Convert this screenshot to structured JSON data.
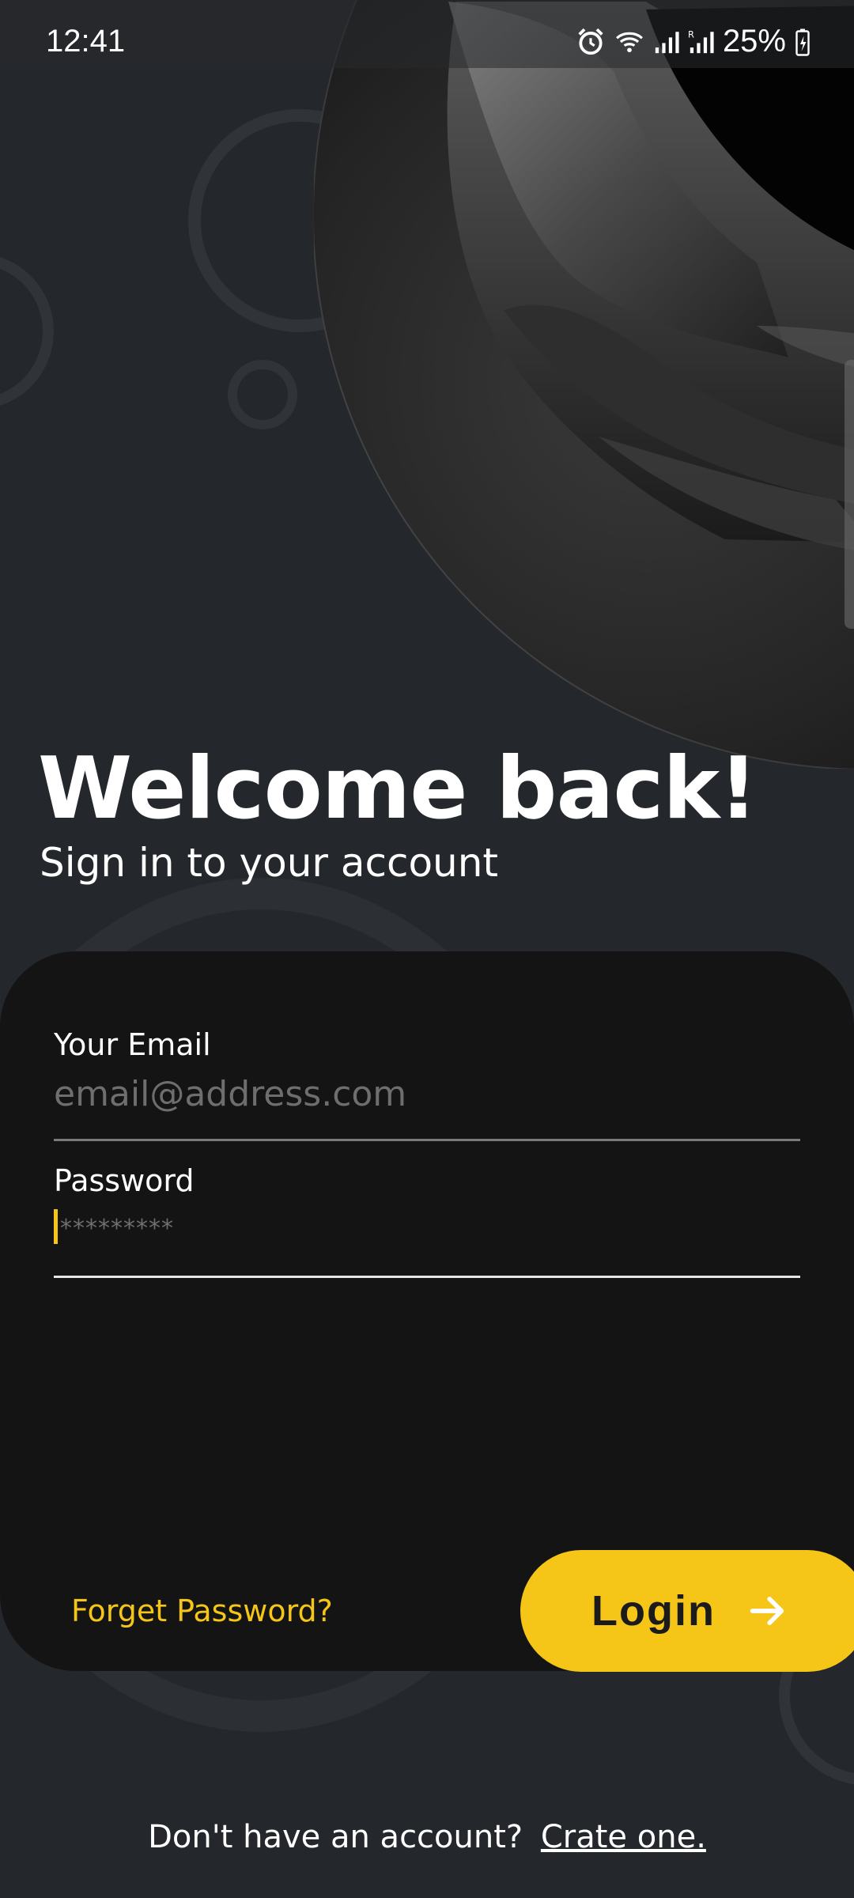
{
  "status_bar": {
    "time": "12:41",
    "battery": "25%",
    "icons": [
      "alarm-icon",
      "wifi-icon",
      "signal-icon",
      "signal-roaming-icon",
      "battery-charging-icon"
    ]
  },
  "hero": {
    "image": "hooded-figure-image"
  },
  "header": {
    "title": "Welcome back!",
    "subtitle": "Sign in to your account"
  },
  "form": {
    "email_label": "Your Email",
    "email_placeholder": "email@address.com",
    "email_value": "",
    "password_label": "Password",
    "password_placeholder": "*********",
    "password_value": ""
  },
  "actions": {
    "forgot_password": "Forget Password?",
    "login_label": "Login"
  },
  "footer": {
    "prompt": "Don't have an account?",
    "signup_link": "Crate one."
  },
  "colors": {
    "background": "#24272b",
    "card": "#141414",
    "accent": "#f5c518",
    "text": "#ffffff"
  }
}
